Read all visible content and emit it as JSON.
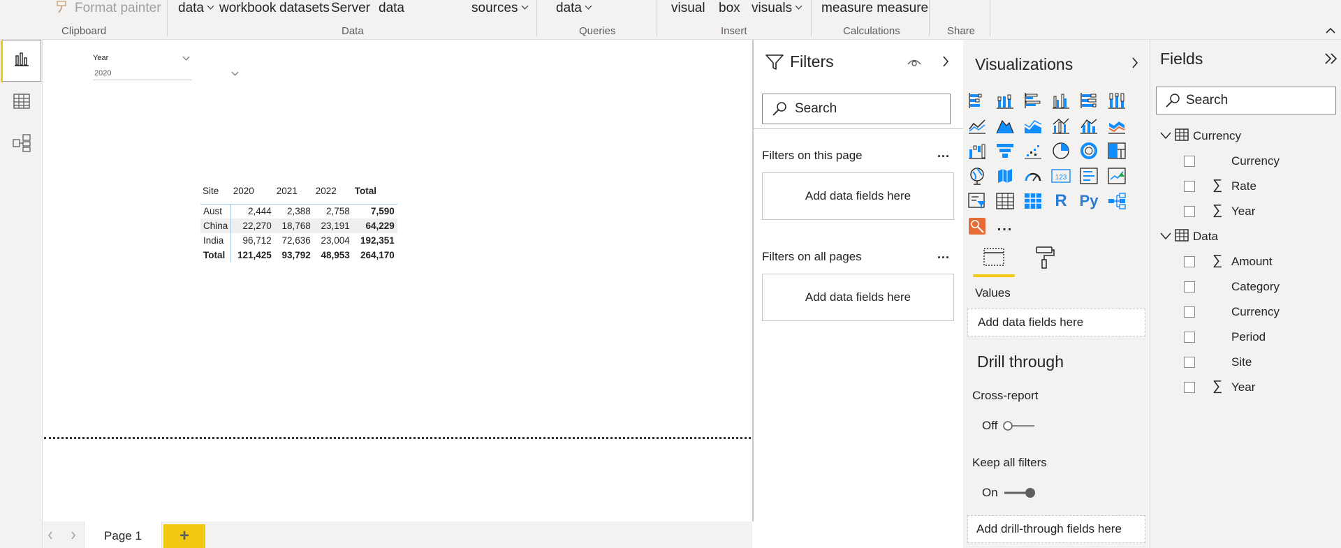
{
  "ribbon": {
    "format_painter": "Format painter",
    "data_items": [
      "data",
      "workbook",
      "datasets",
      "Server",
      "data",
      "sources"
    ],
    "queries_item": "data",
    "insert_items": [
      "visual",
      "box",
      "visuals"
    ],
    "calc_item": "measure measure",
    "groups": {
      "clipboard": "Clipboard",
      "data": "Data",
      "queries": "Queries",
      "insert": "Insert",
      "calculations": "Calculations",
      "share": "Share"
    }
  },
  "slicer": {
    "title": "Year",
    "value": "2020"
  },
  "matrix": {
    "headers": [
      "Site",
      "2020",
      "2021",
      "2022",
      "Total"
    ],
    "rows": [
      {
        "site": "Aust",
        "v2020": "2,444",
        "v2021": "2,388",
        "v2022": "2,758",
        "total": "7,590"
      },
      {
        "site": "China",
        "v2020": "22,270",
        "v2021": "18,768",
        "v2022": "23,191",
        "total": "64,229"
      },
      {
        "site": "India",
        "v2020": "96,712",
        "v2021": "72,636",
        "v2022": "23,004",
        "total": "192,351"
      }
    ],
    "total_row": {
      "site": "Total",
      "v2020": "121,425",
      "v2021": "93,792",
      "v2022": "48,953",
      "total": "264,170"
    }
  },
  "pages": {
    "current": "Page 1",
    "add_symbol": "+"
  },
  "filters": {
    "title": "Filters",
    "search_placeholder": "Search",
    "on_this_page": "Filters on this page",
    "on_all_pages": "Filters on all pages",
    "add_fields": "Add data fields here",
    "more": "..."
  },
  "visualizations": {
    "title": "Visualizations",
    "values_label": "Values",
    "add_fields": "Add data fields here",
    "drill_through": "Drill through",
    "cross_report": "Cross-report",
    "cross_report_state": "Off",
    "keep_all_filters": "Keep all filters",
    "keep_all_filters_state": "On",
    "add_drill": "Add drill-through fields here",
    "r_label": "R",
    "py_label": "Py",
    "num_label": "123",
    "more": "..."
  },
  "fields_pane": {
    "title": "Fields",
    "search_placeholder": "Search",
    "tables": [
      {
        "name": "Currency",
        "fields": [
          "Currency",
          "Rate",
          "Year"
        ]
      },
      {
        "name": "Data",
        "fields": [
          "Amount",
          "Category",
          "Currency",
          "Period",
          "Site",
          "Year"
        ]
      }
    ]
  },
  "colors": {
    "accent_yellow": "#f2c811",
    "viz_blue": "#118dff",
    "icon_blue": "#2b7cd3"
  }
}
